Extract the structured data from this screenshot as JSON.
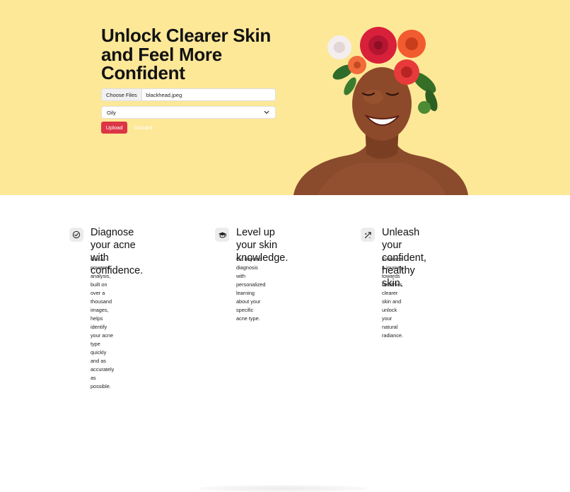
{
  "hero": {
    "headline_line1": "Unlock Clearer Skin",
    "headline_line2": "and Feel More",
    "headline_line3": "Confident",
    "file_button": "Choose Files",
    "file_name": "blackhead.jpeg",
    "skin_type_selected": "Oily",
    "upload_label": "Upload",
    "discard_label": "Discard",
    "background_color": "#fde898",
    "upload_color": "#dc3545"
  },
  "features": [
    {
      "icon": "check-circle-icon",
      "title_line1": "Diagnose your acne with",
      "title_line2": "confidence.",
      "text_line1": "Our AI-powered analysis, built on over a",
      "text_line2": "thousand images, helps identify your acne type",
      "text_line3": "quickly and as accurately as possible."
    },
    {
      "icon": "graduation-cap-icon",
      "title_line1": "Level up your skin",
      "title_line2": "knowledge.",
      "text_line1": "Go beyond diagnosis with personalized learning",
      "text_line2": "about your specific acne type."
    },
    {
      "icon": "sparkle-arrow-icon",
      "title_line1": "Unleash your confident,",
      "title_line2": "healthy skin.",
      "text_line1": "Embrace a journey towards healthier, clearer",
      "text_line2": "skin and unlock your natural radiance."
    }
  ]
}
